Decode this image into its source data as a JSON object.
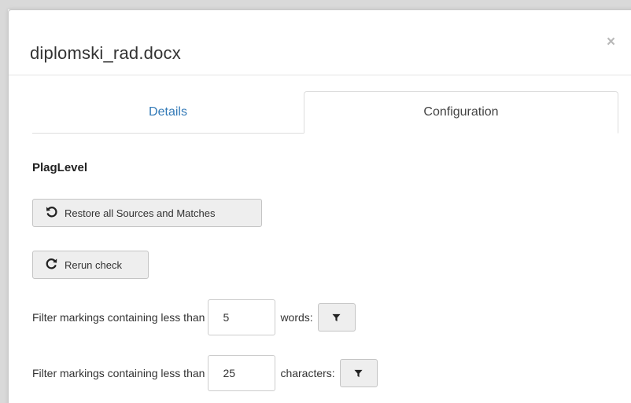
{
  "modal": {
    "title": "diplomski_rad.docx",
    "close_symbol": "×"
  },
  "tabs": [
    {
      "label": "Details",
      "active": false
    },
    {
      "label": "Configuration",
      "active": true
    }
  ],
  "section": {
    "title": "PlagLevel"
  },
  "buttons": {
    "restore_label": "Restore all Sources and Matches",
    "restore_icon": "undo-icon",
    "rerun_label": "Rerun check",
    "rerun_icon": "redo-icon"
  },
  "filters": [
    {
      "label": "Filter markings containing less than",
      "value": "5",
      "unit": "words:",
      "icon": "filter-icon"
    },
    {
      "label": "Filter markings containing less than",
      "value": "25",
      "unit": "characters:",
      "icon": "filter-icon"
    }
  ]
}
